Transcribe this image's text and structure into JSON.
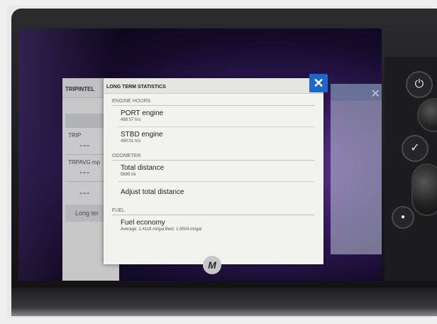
{
  "dialog": {
    "title": "LONG TERM STATISTICS",
    "close_symbol": "✕",
    "sections": [
      {
        "label": "ENGINE HOURS",
        "items": [
          {
            "title": "PORT engine",
            "subtitle": "488:57 hrs"
          },
          {
            "title": "STBD engine",
            "subtitle": "490:01 hrs"
          }
        ]
      },
      {
        "label": "ODOMETER",
        "items": [
          {
            "title": "Total distance",
            "subtitle": "5699 mi"
          },
          {
            "title": "Adjust total distance",
            "subtitle": ""
          }
        ]
      },
      {
        "label": "FUEL",
        "items": [
          {
            "title": "Fuel economy",
            "subtitle": "Average: 1.4118 mi/gal Best: 1.8504 mi/gal"
          }
        ]
      }
    ]
  },
  "trip_panel": {
    "title": "TRIPINTEL",
    "start_label": "St",
    "rows": [
      {
        "label": "TRIP",
        "value": "---"
      },
      {
        "label": "TRPAVG  mp",
        "value": "---"
      },
      {
        "label": "",
        "value": "---"
      }
    ],
    "long_term_label": "Long ter"
  },
  "hardware": {
    "icons": [
      "power-icon",
      "check-icon",
      "waypoint-icon"
    ],
    "power_symbol": "⏻",
    "check_symbol": "✓",
    "waypoint_symbol": "●"
  },
  "logo": {
    "symbol": "M"
  }
}
